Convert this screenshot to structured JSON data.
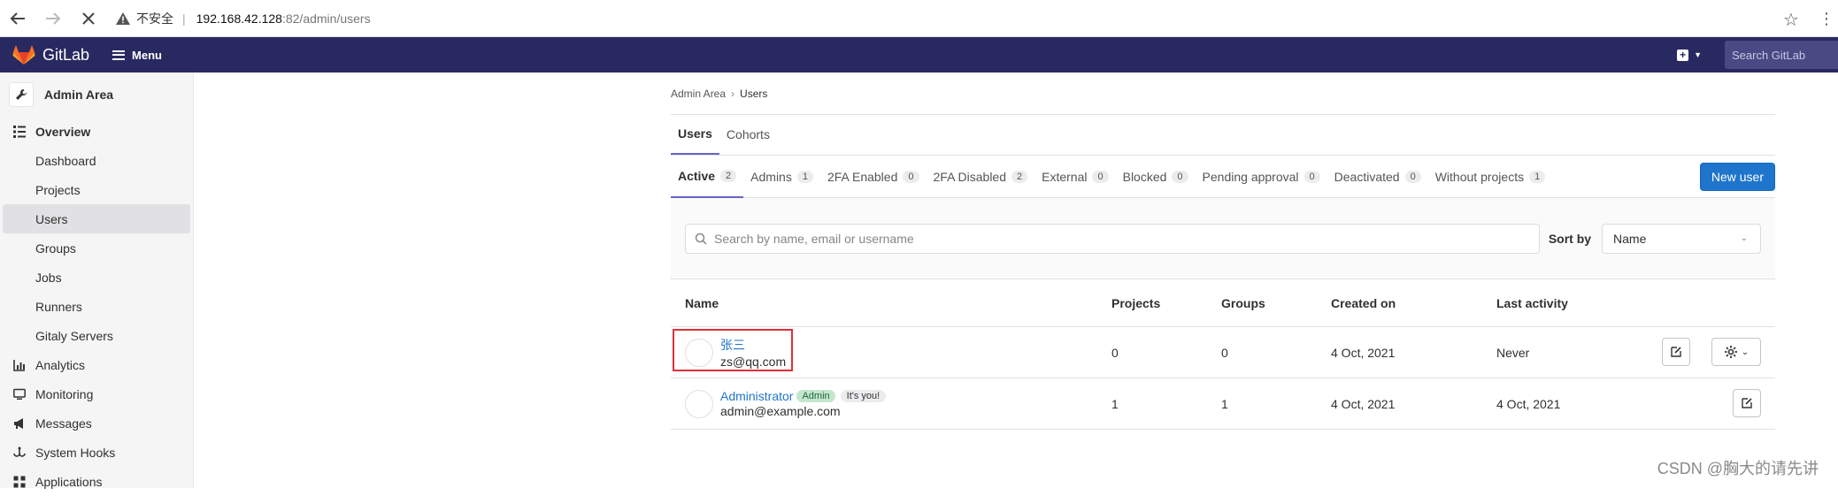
{
  "browser": {
    "insecure_label": "不安全",
    "url_host": "192.168.42.128",
    "url_path": ":82/admin/users"
  },
  "topnav": {
    "brand": "GitLab",
    "menu_label": "Menu",
    "search_placeholder": "Search GitLab"
  },
  "sidebar": {
    "title": "Admin Area",
    "overview": "Overview",
    "items": [
      "Dashboard",
      "Projects",
      "Users",
      "Groups",
      "Jobs",
      "Runners",
      "Gitaly Servers"
    ],
    "sections": [
      "Analytics",
      "Monitoring",
      "Messages",
      "System Hooks",
      "Applications"
    ]
  },
  "breadcrumb": {
    "root": "Admin Area",
    "current": "Users"
  },
  "tabs": [
    "Users",
    "Cohorts"
  ],
  "filters": [
    {
      "label": "Active",
      "count": "2"
    },
    {
      "label": "Admins",
      "count": "1"
    },
    {
      "label": "2FA Enabled",
      "count": "0"
    },
    {
      "label": "2FA Disabled",
      "count": "2"
    },
    {
      "label": "External",
      "count": "0"
    },
    {
      "label": "Blocked",
      "count": "0"
    },
    {
      "label": "Pending approval",
      "count": "0"
    },
    {
      "label": "Deactivated",
      "count": "0"
    },
    {
      "label": "Without projects",
      "count": "1"
    }
  ],
  "new_user_label": "New user",
  "search": {
    "placeholder": "Search by name, email or username",
    "sort_label": "Sort by",
    "sort_value": "Name"
  },
  "table": {
    "headers": {
      "name": "Name",
      "projects": "Projects",
      "groups": "Groups",
      "created": "Created on",
      "activity": "Last activity"
    },
    "rows": [
      {
        "name": "张三",
        "email": "zs@qq.com",
        "projects": "0",
        "groups": "0",
        "created": "4 Oct, 2021",
        "activity": "Never"
      },
      {
        "name": "Administrator",
        "email": "admin@example.com",
        "badge_admin": "Admin",
        "badge_you": "It's you!",
        "projects": "1",
        "groups": "1",
        "created": "4 Oct, 2021",
        "activity": "4 Oct, 2021"
      }
    ]
  },
  "watermark": "CSDN @胸大的请先讲",
  "colors": {
    "nav_bg": "#292961",
    "primary": "#1f75cb",
    "highlight": "#e0303a"
  }
}
